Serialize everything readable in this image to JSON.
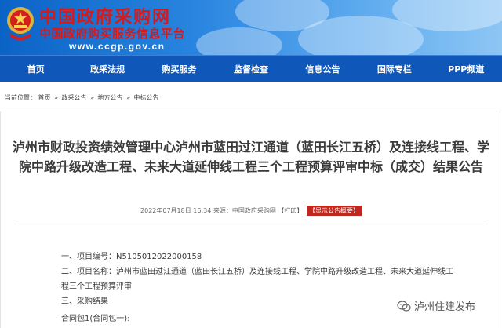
{
  "header": {
    "site_name": "中国政府采购网",
    "site_subtitle": "中国政府购买服务信息平台",
    "url": "www.ccgp.gov.cn"
  },
  "nav": {
    "items": [
      {
        "label": "首页"
      },
      {
        "label": "政采法规"
      },
      {
        "label": "购买服务"
      },
      {
        "label": "监督检查"
      },
      {
        "label": "信息公告"
      },
      {
        "label": "国际专栏"
      },
      {
        "label": "PPP频道"
      }
    ]
  },
  "breadcrumb": {
    "prefix": "当前位置：",
    "items": [
      "首页",
      "政采公告",
      "地方公告",
      "中标公告"
    ],
    "separator": "»"
  },
  "article": {
    "title": "泸州市财政投资绩效管理中心泸州市蓝田过江通道（蓝田长江五桥）及连接线工程、学院中路升级改造工程、未来大道延伸线工程三个工程预算评审中标（成交）结果公告",
    "meta_text": "2022年07月18日 16:34 来源：中国政府采购网",
    "print_label": "【打印】",
    "summary_button": "【显示公告概要】",
    "lines": [
      "一、项目编号：N5105012022000158",
      "二、项目名称：泸州市蓝田过江通道（蓝田长江五桥）及连接线工程、学院中路升级改造工程、未来大道延伸线工",
      "程三个工程预算评审",
      "三、采购结果",
      "合同包1(合同包一):"
    ]
  },
  "watermark": {
    "text": "泸州住建发布"
  },
  "colors": {
    "nav_bg": "#0f57b8",
    "site_name_red": "#d61a1a",
    "summary_btn_red": "#c0271e"
  }
}
